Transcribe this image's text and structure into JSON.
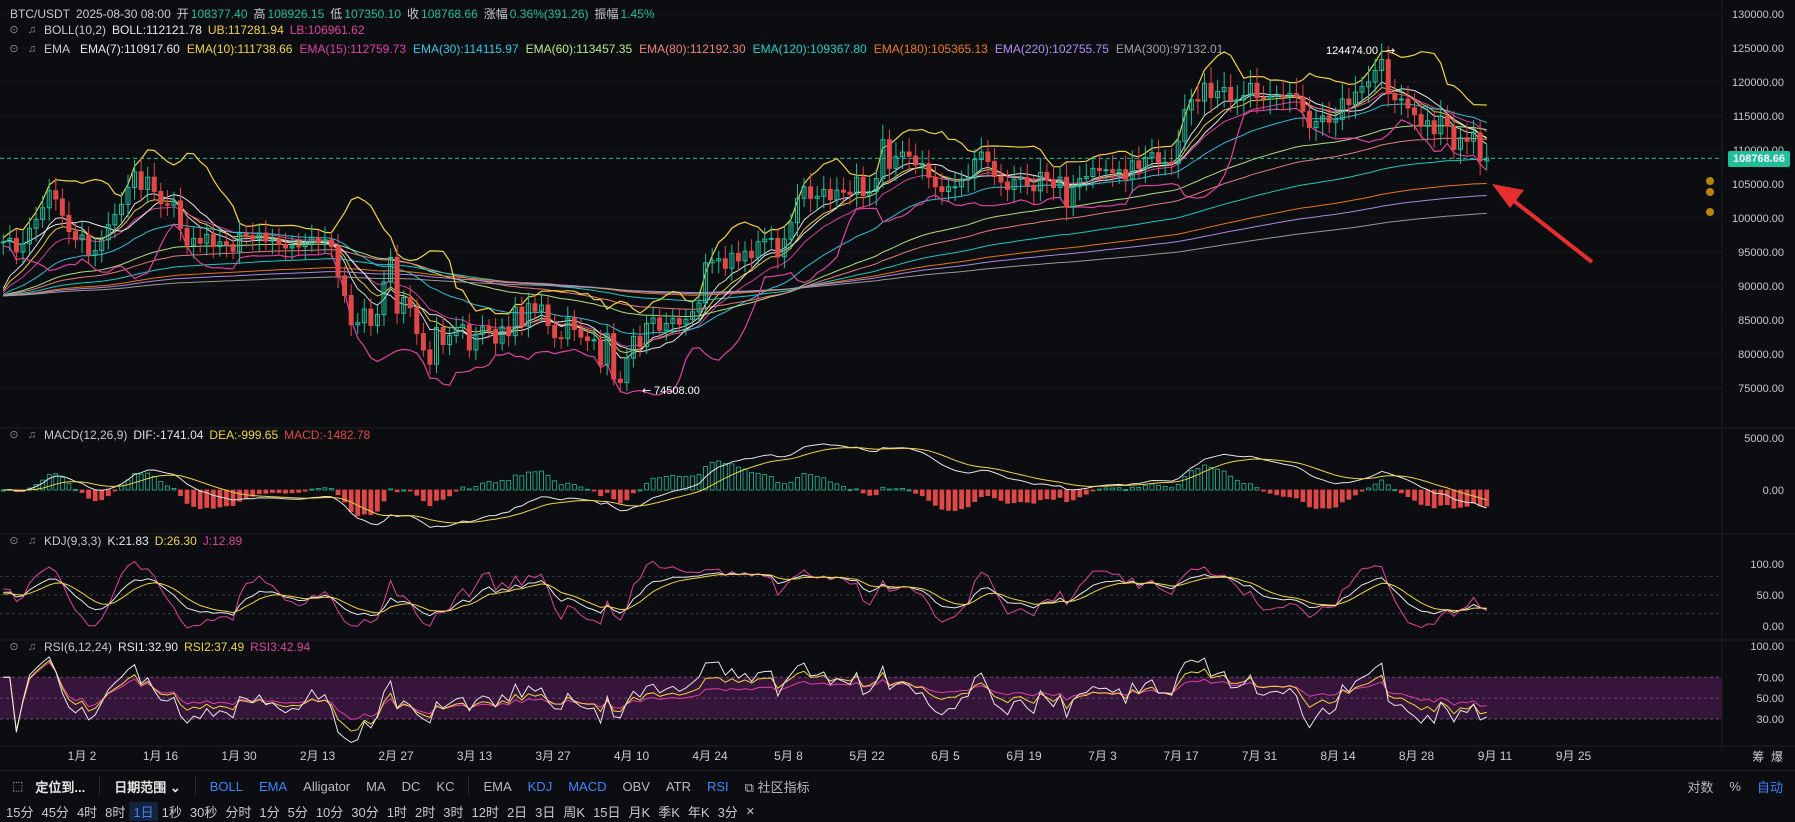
{
  "header": {
    "pair": "BTC/USDT",
    "date": "2025-08-30 08:00",
    "open_label": "开",
    "open": "108377.40",
    "high_label": "高",
    "high": "108926.15",
    "low_label": "低",
    "low": "107350.10",
    "close_label": "收",
    "close": "108768.66",
    "change_label": "涨幅",
    "change": "0.36%(391.26)",
    "amp_label": "振幅",
    "amp": "1.45%"
  },
  "boll": {
    "name": "BOLL(10,2)",
    "mid": "BOLL:112121.78",
    "ub": "UB:117281.94",
    "lb": "LB:106961.62"
  },
  "ema": {
    "name": "EMA",
    "items": [
      {
        "text": "EMA(7):110917.60",
        "color": "#e6e6e6"
      },
      {
        "text": "EMA(10):111738.66",
        "color": "#f2d33c"
      },
      {
        "text": "EMA(15):112759.73",
        "color": "#e040a0"
      },
      {
        "text": "EMA(30):114115.97",
        "color": "#2ec7e6"
      },
      {
        "text": "EMA(60):113457.35",
        "color": "#b8e986"
      },
      {
        "text": "EMA(80):112192.30",
        "color": "#f08080"
      },
      {
        "text": "EMA(120):109367.80",
        "color": "#1fd1c9"
      },
      {
        "text": "EMA(180):105365.13",
        "color": "#f07a1c"
      },
      {
        "text": "EMA(220):102755.75",
        "color": "#b48cf0"
      },
      {
        "text": "EMA(300):97132.01",
        "color": "#a0a0a0"
      }
    ]
  },
  "macd": {
    "name": "MACD(12,26,9)",
    "dif": "DIF:-1741.04",
    "dea": "DEA:-999.65",
    "macd": "MACD:-1482.78"
  },
  "kdj": {
    "name": "KDJ(9,3,3)",
    "k": "K:21.83",
    "d": "D:26.30",
    "j": "J:12.89"
  },
  "rsi": {
    "name": "RSI(6,12,24)",
    "r1": "RSI1:32.90",
    "r2": "RSI2:37.49",
    "r3": "RSI3:42.94"
  },
  "chart_data": {
    "type": "candlestick",
    "title": "BTC/USDT",
    "current_price": "108768.66",
    "annotations": {
      "high": "124474.00",
      "low": "74508.00"
    },
    "price_axis": [
      "130000.00",
      "125000.00",
      "120000.00",
      "115000.00",
      "110000.00",
      "105000.00",
      "100000.00",
      "95000.00",
      "90000.00",
      "85000.00",
      "80000.00",
      "75000.00"
    ],
    "macd_axis": [
      "5000.00",
      "0.00"
    ],
    "kdj_axis": [
      "100.00",
      "50.00",
      "0.00"
    ],
    "rsi_axis": [
      "100.00",
      "70.00",
      "50.00",
      "30.00"
    ],
    "x_labels": [
      "1月 2",
      "1月 16",
      "1月 30",
      "2月 13",
      "2月 27",
      "3月 13",
      "3月 27",
      "4月 10",
      "4月 24",
      "5月 8",
      "5月 22",
      "6月 5",
      "6月 19",
      "7月 3",
      "7月 17",
      "7月 31",
      "8月 14",
      "8月 28",
      "9月 11",
      "9月 25"
    ],
    "ylim": [
      72000,
      131000
    ],
    "close_series": [
      96500,
      97000,
      95000,
      96200,
      98500,
      99800,
      101500,
      104000,
      102800,
      100400,
      98000,
      96800,
      97500,
      94600,
      95200,
      96800,
      99000,
      100500,
      102000,
      104500,
      106800,
      104200,
      106000,
      103900,
      102100,
      101900,
      102500,
      98500,
      96000,
      97000,
      96300,
      97600,
      95800,
      96500,
      96100,
      95100,
      97700,
      97400,
      96900,
      97800,
      96600,
      96800,
      96100,
      95600,
      95900,
      95800,
      96300,
      97100,
      96500,
      96800,
      95800,
      91500,
      88600,
      84300,
      84600,
      86600,
      84200,
      85800,
      90600,
      94200,
      86000,
      88300,
      86800,
      83000,
      80600,
      78500,
      83900,
      81400,
      82700,
      83900,
      84300,
      80600,
      82900,
      84000,
      83600,
      81600,
      84000,
      82700,
      86900,
      84100,
      87400,
      86300,
      87200,
      84200,
      82400,
      82300,
      85300,
      83600,
      82500,
      82000,
      82100,
      78400,
      83000,
      76300,
      75800,
      79400,
      82600,
      81100,
      84500,
      85300,
      83500,
      84500,
      85200,
      84400,
      85100,
      86200,
      87500,
      93400,
      93700,
      94000,
      92600,
      94800,
      93700,
      95100,
      94200,
      96500,
      96900,
      97000,
      94300,
      96900,
      99300,
      102900,
      104600,
      102900,
      103200,
      104200,
      102700,
      104100,
      103800,
      103500,
      106000,
      103300,
      103900,
      105800,
      111500,
      107300,
      109000,
      109700,
      109100,
      107800,
      108000,
      106000,
      104600,
      103900,
      104600,
      104600,
      105700,
      105900,
      108600,
      109700,
      108300,
      106100,
      105300,
      104200,
      105700,
      105900,
      104800,
      104000,
      106700,
      105600,
      104500,
      106000,
      101600,
      104600,
      105800,
      106100,
      107300,
      107000,
      107100,
      106700,
      107100,
      105700,
      108400,
      107300,
      108900,
      109600,
      108200,
      108200,
      108000,
      111300,
      115900,
      117400,
      117200,
      119800,
      117700,
      118600,
      119200,
      117300,
      117400,
      118000,
      119800,
      117700,
      117500,
      117900,
      118000,
      117800,
      118300,
      117800,
      115700,
      113300,
      114200,
      115000,
      114100,
      114500,
      117500,
      116700,
      118500,
      119300,
      120000,
      121700,
      123300,
      118300,
      117400,
      117500,
      116200,
      115200,
      113500,
      114300,
      112400,
      115000,
      113500,
      110100,
      111800,
      111300,
      112500,
      108400,
      108800
    ]
  }
}
